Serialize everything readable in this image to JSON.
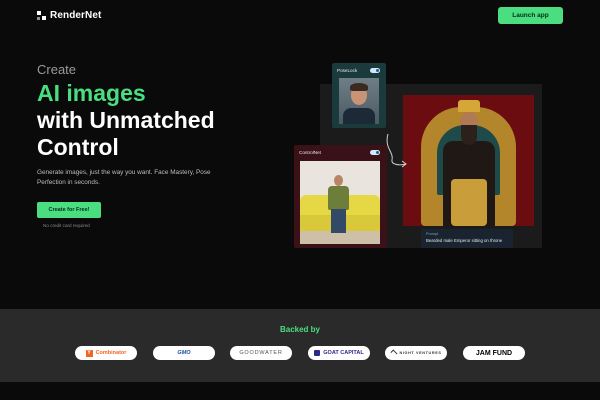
{
  "brand": {
    "name": "RenderNet"
  },
  "header": {
    "launch_label": "Launch app"
  },
  "hero": {
    "eyebrow": "Create",
    "title_accent": "AI images",
    "title_line2": "with Unmatched",
    "title_line3": "Control",
    "description": "Generate images, just the way you want. Face Mastery, Pose Perfection in seconds.",
    "cta_label": "Create for Free!",
    "cta_note": "No credit card required"
  },
  "showcase": {
    "poselock_label": "PoseLock",
    "controlnet_label": "ControlNet",
    "prompt_label": "Prompt",
    "prompt_text": "Bearded male Emperor sitting on throne"
  },
  "backed": {
    "title": "Backed by",
    "backers": [
      {
        "name": "Combinator",
        "mark": "Y"
      },
      {
        "name": "GMO"
      },
      {
        "name": "GOODWATER"
      },
      {
        "name": "GOAT CAPITAL"
      },
      {
        "name": "NIGHT VENTURES"
      },
      {
        "name": "JAM FUND"
      }
    ]
  },
  "colors": {
    "accent": "#4ade80",
    "background": "#0a0a0a",
    "backed_bg": "#2a2a2a",
    "poselock_card": "#1a3a3c",
    "controlnet_card": "#3a1117",
    "prompt_box": "#1a2430"
  },
  "icons": {
    "logo": "rendernet-logo-icon",
    "toggle": "toggle-on-icon",
    "arrow": "curved-arrow-icon"
  }
}
